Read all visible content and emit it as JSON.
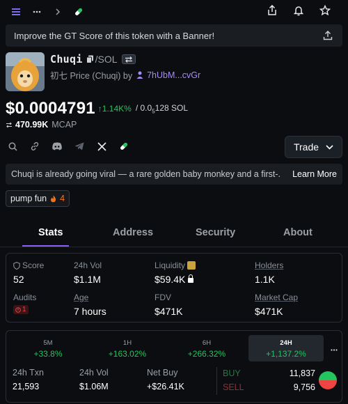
{
  "banner": {
    "text": "Improve the GT Score of this token with a Banner!"
  },
  "token": {
    "name": "Chuqi",
    "pair_quote": "/SOL",
    "subtitle_prefix": "初七 Price (Chuqi) by",
    "creator": "7hUbM...cvGr"
  },
  "price": {
    "usd": "$0.0004791",
    "change": "↑1.14K%",
    "sol_prefix": "/ 0.0",
    "sol_sub": "5",
    "sol_suffix": "128 SOL",
    "mcap_value": "470.99K",
    "mcap_label": "MCAP"
  },
  "trade_label": "Trade",
  "description": {
    "text": "Chuqi is already going viral — a rare golden baby monkey and a first-...",
    "more": "Learn More"
  },
  "tag": {
    "label": "pump fun",
    "count": "4"
  },
  "tabs": [
    {
      "label": "Stats"
    },
    {
      "label": "Address"
    },
    {
      "label": "Security"
    },
    {
      "label": "About"
    }
  ],
  "stats": {
    "score_label": "Score",
    "score_value": "52",
    "vol_label": "24h Vol",
    "vol_value": "$1.1M",
    "liq_label": "Liquidity",
    "liq_value": "$59.4K",
    "holders_label": "Holders",
    "holders_value": "1.1K",
    "audits_label": "Audits",
    "audits_value": "1",
    "age_label": "Age",
    "age_value": "7 hours",
    "fdv_label": "FDV",
    "fdv_value": "$471K",
    "mcap_label": "Market Cap",
    "mcap_value": "$471K"
  },
  "timeframes": [
    {
      "key": "5M",
      "value": "+33.8%"
    },
    {
      "key": "1H",
      "value": "+163.02%"
    },
    {
      "key": "6H",
      "value": "+266.32%"
    },
    {
      "key": "24H",
      "value": "+1,137.2%"
    }
  ],
  "tx": {
    "txn_label": "24h Txn",
    "txn_value": "21,593",
    "vol_label": "24h Vol",
    "vol_value": "$1.06M",
    "netbuy_label": "Net Buy",
    "netbuy_value": "+$26.41K",
    "buy_label": "BUY",
    "buy_value": "11,837",
    "sell_label": "SELL",
    "sell_value": "9,756"
  },
  "colors": {
    "accent": "#8b5cf6",
    "positive": "#22c55e",
    "negative": "#ef4444",
    "score": "#f97316"
  }
}
